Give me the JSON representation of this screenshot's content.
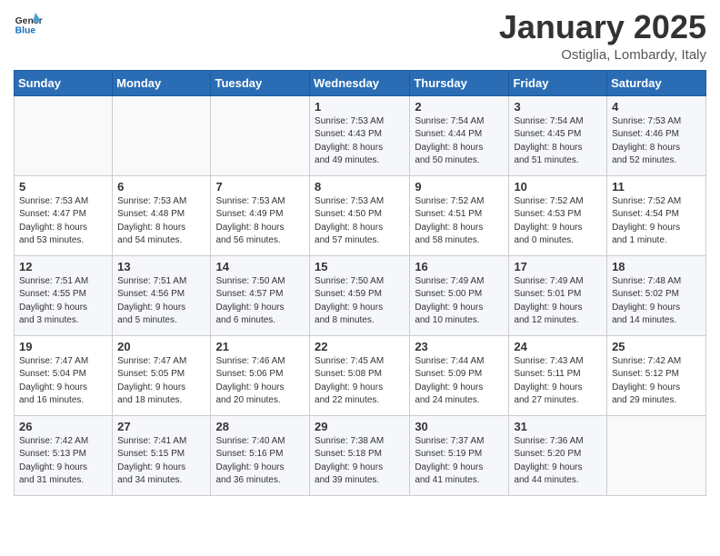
{
  "header": {
    "logo_text_general": "General",
    "logo_text_blue": "Blue",
    "month_title": "January 2025",
    "location": "Ostiglia, Lombardy, Italy"
  },
  "days_of_week": [
    "Sunday",
    "Monday",
    "Tuesday",
    "Wednesday",
    "Thursday",
    "Friday",
    "Saturday"
  ],
  "weeks": [
    [
      {
        "day": "",
        "info": ""
      },
      {
        "day": "",
        "info": ""
      },
      {
        "day": "",
        "info": ""
      },
      {
        "day": "1",
        "info": "Sunrise: 7:53 AM\nSunset: 4:43 PM\nDaylight: 8 hours\nand 49 minutes."
      },
      {
        "day": "2",
        "info": "Sunrise: 7:54 AM\nSunset: 4:44 PM\nDaylight: 8 hours\nand 50 minutes."
      },
      {
        "day": "3",
        "info": "Sunrise: 7:54 AM\nSunset: 4:45 PM\nDaylight: 8 hours\nand 51 minutes."
      },
      {
        "day": "4",
        "info": "Sunrise: 7:53 AM\nSunset: 4:46 PM\nDaylight: 8 hours\nand 52 minutes."
      }
    ],
    [
      {
        "day": "5",
        "info": "Sunrise: 7:53 AM\nSunset: 4:47 PM\nDaylight: 8 hours\nand 53 minutes."
      },
      {
        "day": "6",
        "info": "Sunrise: 7:53 AM\nSunset: 4:48 PM\nDaylight: 8 hours\nand 54 minutes."
      },
      {
        "day": "7",
        "info": "Sunrise: 7:53 AM\nSunset: 4:49 PM\nDaylight: 8 hours\nand 56 minutes."
      },
      {
        "day": "8",
        "info": "Sunrise: 7:53 AM\nSunset: 4:50 PM\nDaylight: 8 hours\nand 57 minutes."
      },
      {
        "day": "9",
        "info": "Sunrise: 7:52 AM\nSunset: 4:51 PM\nDaylight: 8 hours\nand 58 minutes."
      },
      {
        "day": "10",
        "info": "Sunrise: 7:52 AM\nSunset: 4:53 PM\nDaylight: 9 hours\nand 0 minutes."
      },
      {
        "day": "11",
        "info": "Sunrise: 7:52 AM\nSunset: 4:54 PM\nDaylight: 9 hours\nand 1 minute."
      }
    ],
    [
      {
        "day": "12",
        "info": "Sunrise: 7:51 AM\nSunset: 4:55 PM\nDaylight: 9 hours\nand 3 minutes."
      },
      {
        "day": "13",
        "info": "Sunrise: 7:51 AM\nSunset: 4:56 PM\nDaylight: 9 hours\nand 5 minutes."
      },
      {
        "day": "14",
        "info": "Sunrise: 7:50 AM\nSunset: 4:57 PM\nDaylight: 9 hours\nand 6 minutes."
      },
      {
        "day": "15",
        "info": "Sunrise: 7:50 AM\nSunset: 4:59 PM\nDaylight: 9 hours\nand 8 minutes."
      },
      {
        "day": "16",
        "info": "Sunrise: 7:49 AM\nSunset: 5:00 PM\nDaylight: 9 hours\nand 10 minutes."
      },
      {
        "day": "17",
        "info": "Sunrise: 7:49 AM\nSunset: 5:01 PM\nDaylight: 9 hours\nand 12 minutes."
      },
      {
        "day": "18",
        "info": "Sunrise: 7:48 AM\nSunset: 5:02 PM\nDaylight: 9 hours\nand 14 minutes."
      }
    ],
    [
      {
        "day": "19",
        "info": "Sunrise: 7:47 AM\nSunset: 5:04 PM\nDaylight: 9 hours\nand 16 minutes."
      },
      {
        "day": "20",
        "info": "Sunrise: 7:47 AM\nSunset: 5:05 PM\nDaylight: 9 hours\nand 18 minutes."
      },
      {
        "day": "21",
        "info": "Sunrise: 7:46 AM\nSunset: 5:06 PM\nDaylight: 9 hours\nand 20 minutes."
      },
      {
        "day": "22",
        "info": "Sunrise: 7:45 AM\nSunset: 5:08 PM\nDaylight: 9 hours\nand 22 minutes."
      },
      {
        "day": "23",
        "info": "Sunrise: 7:44 AM\nSunset: 5:09 PM\nDaylight: 9 hours\nand 24 minutes."
      },
      {
        "day": "24",
        "info": "Sunrise: 7:43 AM\nSunset: 5:11 PM\nDaylight: 9 hours\nand 27 minutes."
      },
      {
        "day": "25",
        "info": "Sunrise: 7:42 AM\nSunset: 5:12 PM\nDaylight: 9 hours\nand 29 minutes."
      }
    ],
    [
      {
        "day": "26",
        "info": "Sunrise: 7:42 AM\nSunset: 5:13 PM\nDaylight: 9 hours\nand 31 minutes."
      },
      {
        "day": "27",
        "info": "Sunrise: 7:41 AM\nSunset: 5:15 PM\nDaylight: 9 hours\nand 34 minutes."
      },
      {
        "day": "28",
        "info": "Sunrise: 7:40 AM\nSunset: 5:16 PM\nDaylight: 9 hours\nand 36 minutes."
      },
      {
        "day": "29",
        "info": "Sunrise: 7:38 AM\nSunset: 5:18 PM\nDaylight: 9 hours\nand 39 minutes."
      },
      {
        "day": "30",
        "info": "Sunrise: 7:37 AM\nSunset: 5:19 PM\nDaylight: 9 hours\nand 41 minutes."
      },
      {
        "day": "31",
        "info": "Sunrise: 7:36 AM\nSunset: 5:20 PM\nDaylight: 9 hours\nand 44 minutes."
      },
      {
        "day": "",
        "info": ""
      }
    ]
  ]
}
